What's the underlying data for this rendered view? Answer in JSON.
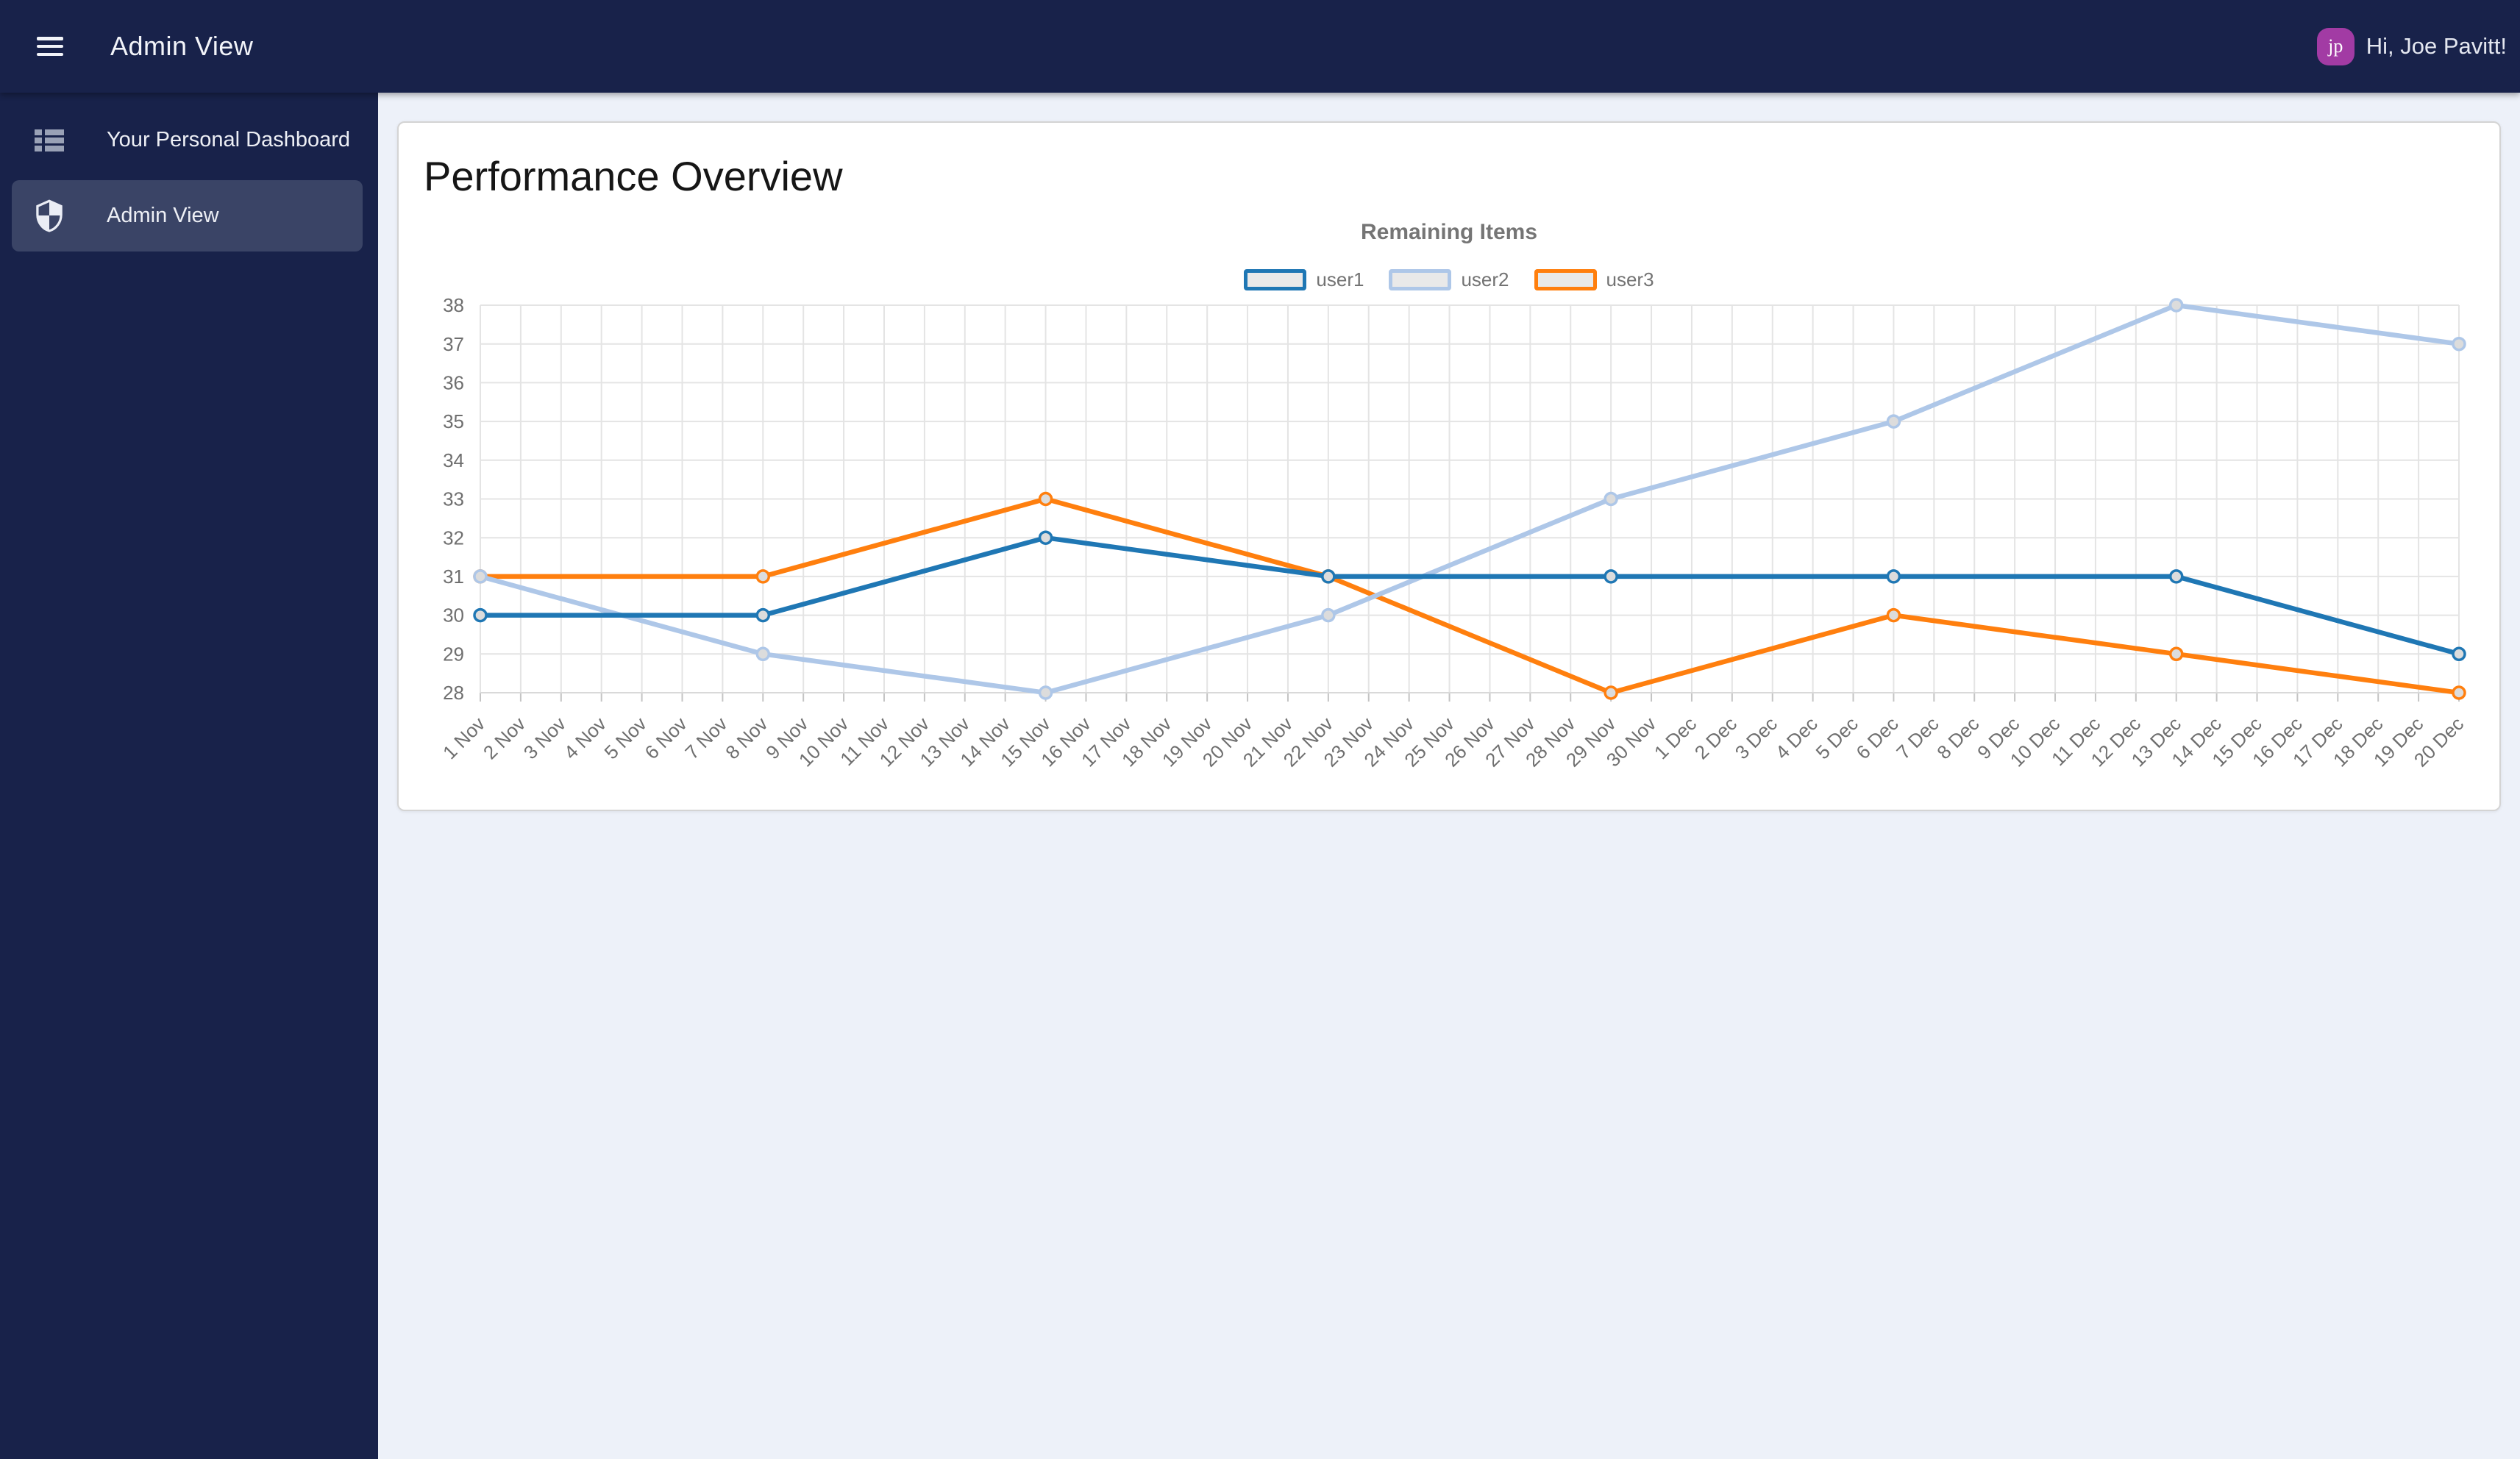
{
  "header": {
    "title": "Admin View",
    "greeting": "Hi, Joe Pavitt!",
    "avatar_initials": "jp",
    "avatar_color": "#A23BA4"
  },
  "sidebar": {
    "items": [
      {
        "label": "Your Personal Dashboard",
        "icon": "view-list-icon",
        "active": false
      },
      {
        "label": "Admin View",
        "icon": "shield-icon",
        "active": true
      }
    ]
  },
  "main": {
    "card_title": "Performance Overview"
  },
  "colors": {
    "header_bg": "#18224A",
    "sidebar_bg": "#18224A",
    "selected_item_bg": "#3A4466",
    "main_bg": "#EDF1F9",
    "chart_text": "#757575",
    "grid_line": "#E4E4E4",
    "axis_line": "#D9D9D9",
    "tick_mark": "#C4C4C4",
    "point_fill": "#DCDCDC"
  },
  "chart_data": {
    "type": "line",
    "title": "Remaining Items",
    "xlabel": "",
    "ylabel": "",
    "ylim": [
      28,
      38
    ],
    "y_step": 1,
    "grid": true,
    "legend_position": "top",
    "categories": [
      "1 Nov",
      "2 Nov",
      "3 Nov",
      "4 Nov",
      "5 Nov",
      "6 Nov",
      "7 Nov",
      "8 Nov",
      "9 Nov",
      "10 Nov",
      "11 Nov",
      "12 Nov",
      "13 Nov",
      "14 Nov",
      "15 Nov",
      "16 Nov",
      "17 Nov",
      "18 Nov",
      "19 Nov",
      "20 Nov",
      "21 Nov",
      "22 Nov",
      "23 Nov",
      "24 Nov",
      "25 Nov",
      "26 Nov",
      "27 Nov",
      "28 Nov",
      "29 Nov",
      "30 Nov",
      "1 Dec",
      "2 Dec",
      "3 Dec",
      "4 Dec",
      "5 Dec",
      "6 Dec",
      "7 Dec",
      "8 Dec",
      "9 Dec",
      "10 Dec",
      "11 Dec",
      "12 Dec",
      "13 Dec",
      "14 Dec",
      "15 Dec",
      "16 Dec",
      "17 Dec",
      "18 Dec",
      "19 Dec",
      "20 Dec"
    ],
    "point_categories": [
      "1 Nov",
      "8 Nov",
      "15 Nov",
      "22 Nov",
      "29 Nov",
      "6 Dec",
      "13 Dec",
      "20 Dec"
    ],
    "series": [
      {
        "name": "user1",
        "color": "#1F77B4",
        "values": [
          30,
          30,
          32,
          31,
          31,
          31,
          31,
          29
        ]
      },
      {
        "name": "user2",
        "color": "#AEC7E8",
        "values": [
          31,
          29,
          28,
          30,
          33,
          35,
          38,
          37
        ]
      },
      {
        "name": "user3",
        "color": "#FF7F0E",
        "values": [
          31,
          31,
          33,
          31,
          28,
          30,
          29,
          28
        ]
      }
    ]
  }
}
